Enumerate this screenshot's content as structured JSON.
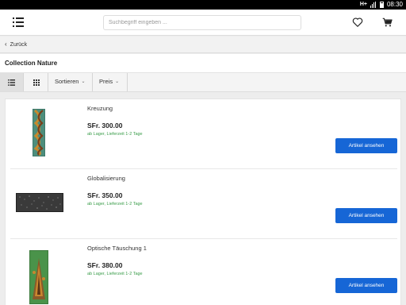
{
  "status_bar": {
    "network": "H+",
    "time": "08:30"
  },
  "header": {
    "search_placeholder": "Suchbegriff eingeben ..."
  },
  "back": {
    "label": "Zurück"
  },
  "page": {
    "title": "Collection Nature"
  },
  "toolbar": {
    "sort_label": "Sortieren",
    "price_label": "Preis"
  },
  "products": [
    {
      "name": "Kreuzung",
      "price": "SFr. 300.00",
      "availability": "ab Lager, Lieferzeit 1-2 Tage",
      "button": "Artikel ansehen"
    },
    {
      "name": "Globalisierung",
      "price": "SFr. 350.00",
      "availability": "ab Lager, Lieferzeit 1-2 Tage",
      "button": "Artikel ansehen"
    },
    {
      "name": "Optische Täuschung 1",
      "price": "SFr. 380.00",
      "availability": "ab Lager, Lieferzeit 1-2 Tage",
      "button": "Artikel ansehen"
    }
  ],
  "colors": {
    "accent": "#1666d6",
    "stock": "#3a9d4a"
  }
}
